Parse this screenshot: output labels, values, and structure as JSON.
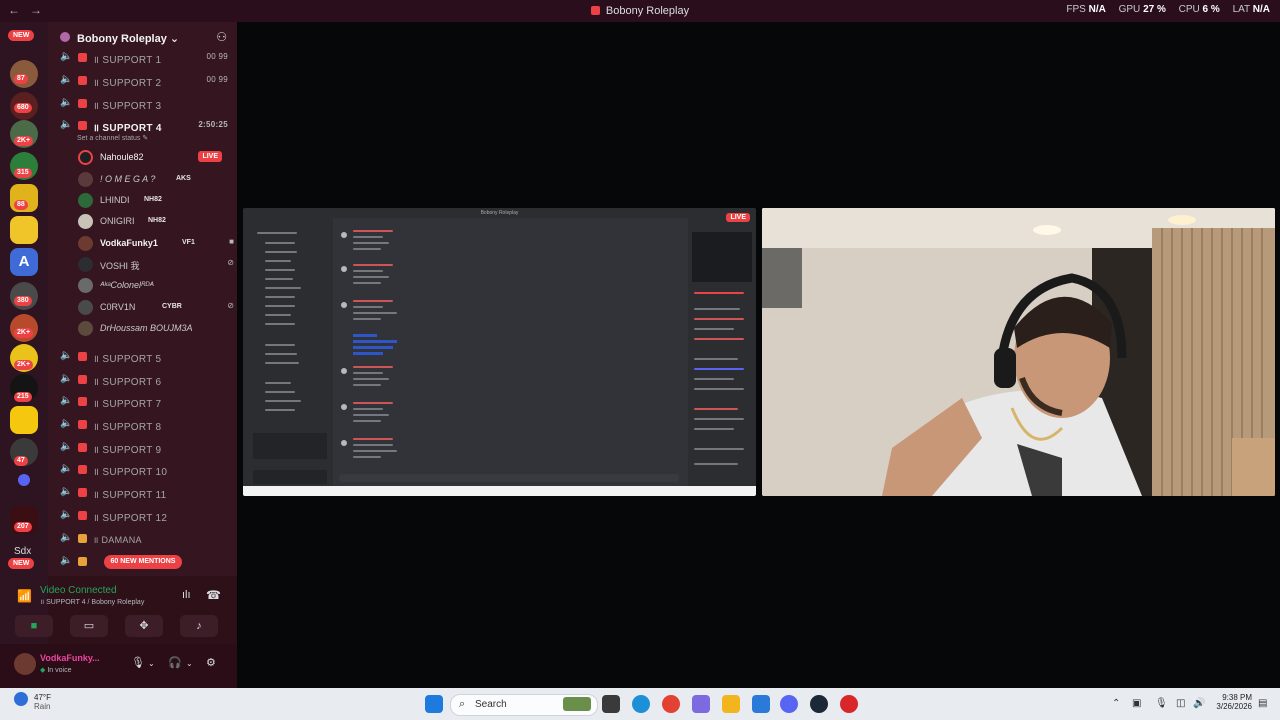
{
  "titlebar": {
    "title": "Bobony Roleplay",
    "fps_label": "FPS",
    "fps_value": "N/A",
    "gpu_label": "GPU",
    "gpu_value": "27 %",
    "cpu_label": "CPU",
    "cpu_value": "6 %",
    "lat_label": "LAT",
    "lat_value": "N/A"
  },
  "rail": {
    "new_top": "NEW",
    "new_bottom": "NEW",
    "sdx": "Sdx",
    "badges": [
      "87",
      "680",
      "2K+",
      "315",
      "88",
      "380",
      "2K+",
      "2K+",
      "215",
      "47",
      "207"
    ]
  },
  "server": {
    "name": "Bobony Roleplay"
  },
  "channels": [
    {
      "label": "॥ SUPPORT 1",
      "status": "00  99"
    },
    {
      "label": "॥ SUPPORT 2",
      "status": "00  99"
    },
    {
      "label": "॥ SUPPORT 3",
      "status": ""
    },
    {
      "label": "॥ SUPPORT 4",
      "status": "2:50:25",
      "sub": "Set a channel status ✎"
    }
  ],
  "voice_users": [
    {
      "name": "Nahoule82",
      "tag": "",
      "live": "LIVE"
    },
    {
      "name": "! O M E G A ?",
      "tag": "AKS"
    },
    {
      "name": "LHINDI",
      "tag": "NH82"
    },
    {
      "name": "ONIGIRI",
      "tag": "NH82"
    },
    {
      "name": "VodkaFunky1",
      "tag": "VF1"
    },
    {
      "name": "VOSHI 我",
      "tag": ""
    },
    {
      "name": "ᴬᵏᵃColonelᴿᴰᴬ",
      "tag": ""
    },
    {
      "name": "C0RV1N",
      "tag": "CYBR"
    },
    {
      "name": "DrHoussam BOUJM3A",
      "tag": ""
    }
  ],
  "channels_bottom": [
    {
      "label": "॥ SUPPORT 5"
    },
    {
      "label": "॥ SUPPORT 6"
    },
    {
      "label": "॥ SUPPORT 7"
    },
    {
      "label": "॥ SUPPORT 8"
    },
    {
      "label": "॥ SUPPORT 9"
    },
    {
      "label": "॥ SUPPORT 10"
    },
    {
      "label": "॥ SUPPORT 11"
    },
    {
      "label": "॥ SUPPORT 12"
    },
    {
      "label": "॥ DAMANA"
    }
  ],
  "mentions": "60 NEW MENTIONS",
  "voice_connection": {
    "status": "Video Connected",
    "channel": "॥ SUPPORT 4 / Bobony Roleplay"
  },
  "user_panel": {
    "name": "VodkaFunky...",
    "sub": "In voice"
  },
  "stream_live": "LIVE",
  "taskbar": {
    "weather_temp": "47°F",
    "weather_desc": "Rain",
    "search": "Search",
    "time": "9:38 PM",
    "date": "3/26/2026"
  },
  "colors": {
    "accent": "#ed4245",
    "sidebar": "#35151f",
    "rail": "#2d1420",
    "voice_green": "#23a55a",
    "mention_pink": "#eb459e"
  }
}
